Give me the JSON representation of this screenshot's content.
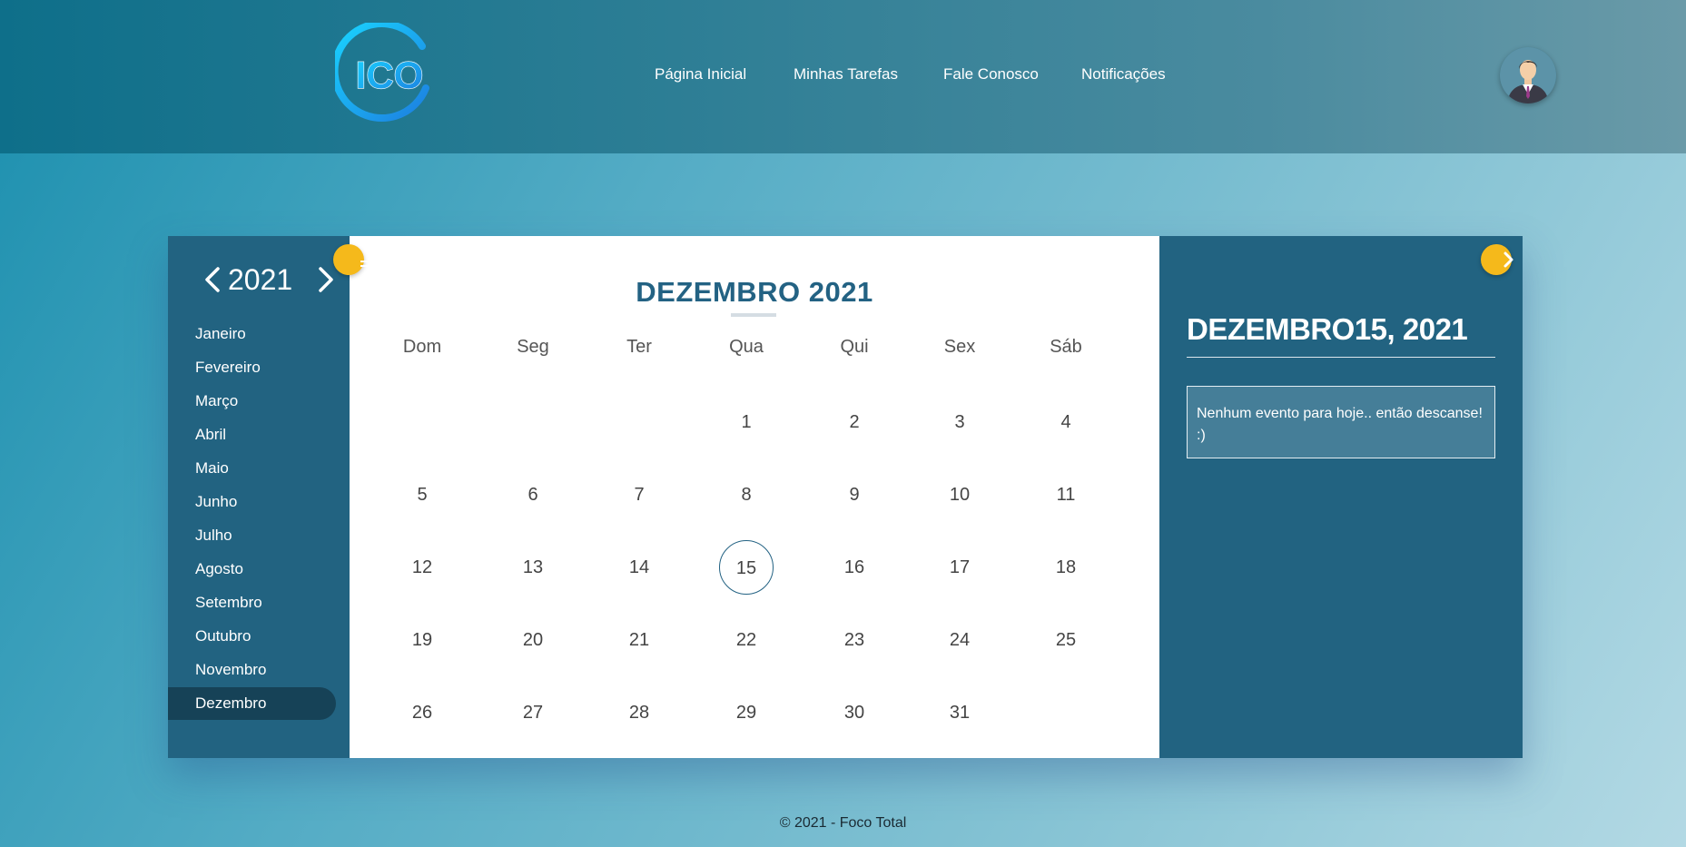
{
  "header": {
    "logo_text": "ICO",
    "nav": [
      "Página Inicial",
      "Minhas Tarefas",
      "Fale Conosco",
      "Notificações"
    ]
  },
  "calendar": {
    "year": "2021",
    "months": [
      "Janeiro",
      "Fevereiro",
      "Março",
      "Abril",
      "Maio",
      "Junho",
      "Julho",
      "Agosto",
      "Setembro",
      "Outubro",
      "Novembro",
      "Dezembro"
    ],
    "active_month": "Dezembro",
    "title": "DEZEMBRO 2021",
    "weekdays": [
      "Dom",
      "Seg",
      "Ter",
      "Qua",
      "Qui",
      "Sex",
      "Sáb"
    ],
    "days": [
      "",
      "",
      "",
      "1",
      "2",
      "3",
      "4",
      "5",
      "6",
      "7",
      "8",
      "9",
      "10",
      "11",
      "12",
      "13",
      "14",
      "15",
      "16",
      "17",
      "18",
      "19",
      "20",
      "21",
      "22",
      "23",
      "24",
      "25",
      "26",
      "27",
      "28",
      "29",
      "30",
      "31",
      ""
    ],
    "today": "15"
  },
  "panel": {
    "date": "DEZEMBRO15, 2021",
    "message": "Nenhum evento para hoje.. então descanse! :)"
  },
  "footer": {
    "text": "© 2021 - Foco Total"
  },
  "colors": {
    "accent": "#236283",
    "highlight": "#f5b91b",
    "active_month_bg": "#164257"
  },
  "icons": [
    "logo-icon",
    "avatar",
    "chevron-left-icon",
    "chevron-right-icon",
    "menu-icon"
  ]
}
